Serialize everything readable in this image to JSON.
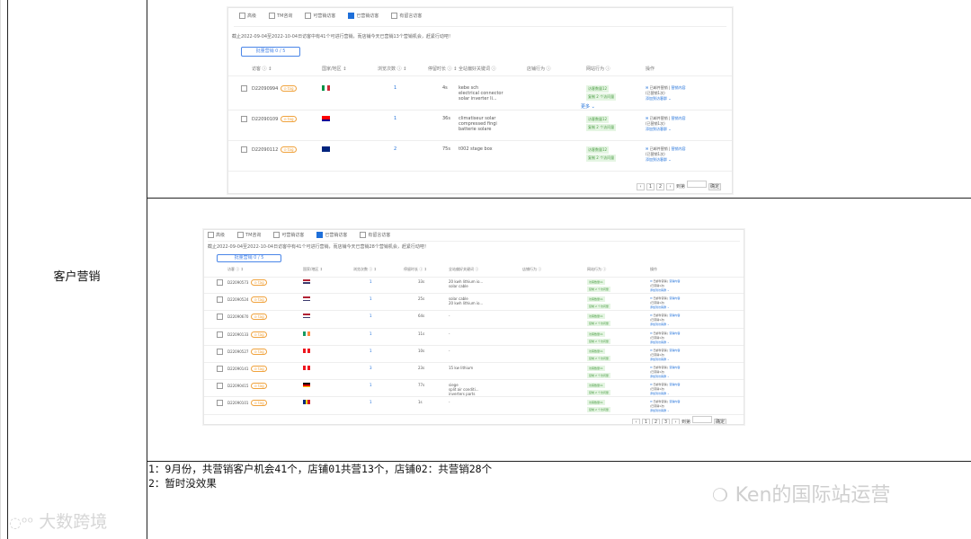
{
  "section_label": "客户营销",
  "notes": [
    "1：9月份，共营销客户机会41个，店铺01共营13个，店铺02：共营销28个",
    "2：暂时没效果"
  ],
  "watermark_left": "大数跨境",
  "watermark_right": "Ken的国际站运营",
  "shot1": {
    "filters": [
      "高级",
      "TM咨询",
      "可营销访客",
      "已营销访客",
      "有留言访客"
    ],
    "filters_checked": [
      false,
      false,
      false,
      true,
      false
    ],
    "notice": "截止2022-09-04至2022-10-04日访客中有41个可进行营销，而店铺今天已营销13个营销机会，赶紧行动吧！",
    "batch_button": "批量营销 0 / 5",
    "headers": [
      "访客 ⓘ ↕",
      "国家/地区 ↕",
      "浏览次数 ⓘ ↕",
      "停留时长 ⓘ ↕",
      "全站偏好关键词 ⓘ",
      "店铺行为 ⓘ",
      "网站行为 ⓘ",
      "操作"
    ],
    "rows": [
      {
        "id": "D22090994",
        "flag": "it",
        "visits": "1",
        "stay": "4s",
        "keywords": [
          "kebe sch",
          "electrical connector",
          "solar inverter li..."
        ],
        "more": "更多 ⌄"
      },
      {
        "id": "D22090109",
        "flag": "tw",
        "visits": "1",
        "stay": "36s",
        "keywords": [
          "climatiseur solar",
          "compressed fingi",
          "batterie solare"
        ],
        "more": ""
      },
      {
        "id": "D22090112",
        "flag": "au",
        "visits": "2",
        "stay": "75s",
        "keywords": [
          "t002 stage box"
        ],
        "more": ""
      }
    ],
    "green_labels": [
      "访客数量12",
      "复制 2 个访问量"
    ],
    "ops": [
      "已邮件营销",
      "营销内容",
      "(已营销1次)",
      "添加到访客群 ⌄"
    ],
    "pager": [
      "‹",
      "1",
      "2",
      "›",
      "到第",
      "确定"
    ]
  },
  "shot2": {
    "filters": [
      "高级",
      "TM咨询",
      "可营销访客",
      "已营销访客",
      "有留言访客"
    ],
    "filters_checked": [
      false,
      false,
      false,
      true,
      false
    ],
    "notice": "截止2022-09-04至2022-10-04日访客中有41个可进行营销，而店铺今天已营销28个营销机会，赶紧行动吧！",
    "batch_button": "批量营销 0 / 5",
    "headers": [
      "访客 ⓘ ↕",
      "国家/地区 ↕",
      "浏览次数 ⓘ ↕",
      "停留时长 ⓘ ↕",
      "全站偏好关键词 ⓘ",
      "店铺行为 ⓘ",
      "网站行为 ⓘ",
      "操作"
    ],
    "rows": [
      {
        "id": "D22090573",
        "flag": "us",
        "visits": "1",
        "stay": "33s",
        "keywords": [
          "20 kwh lithium io...",
          "solar cable"
        ]
      },
      {
        "id": "D22090524",
        "flag": "us",
        "visits": "1",
        "stay": "25s",
        "keywords": [
          "solar cable",
          "20 kwh lithium io..."
        ]
      },
      {
        "id": "D22090670",
        "flag": "us",
        "visits": "1",
        "stay": "64s",
        "keywords": [
          "-"
        ]
      },
      {
        "id": "D22090133",
        "flag": "ie",
        "visits": "1",
        "stay": "11s",
        "keywords": [
          "-"
        ]
      },
      {
        "id": "D22090527",
        "flag": "lb",
        "visits": "1",
        "stay": "10s",
        "keywords": [
          "-"
        ]
      },
      {
        "id": "D22090141",
        "flag": "lb",
        "visits": "3",
        "stay": "23s",
        "keywords": [
          "15 kw lithium"
        ]
      },
      {
        "id": "D22090415",
        "flag": "de",
        "visits": "1",
        "stay": "77s",
        "keywords": [
          "siege",
          "split air conditi...",
          "inverters parts"
        ]
      },
      {
        "id": "D22090101",
        "flag": "ro",
        "visits": "1",
        "stay": "1s",
        "keywords": [
          "-"
        ]
      }
    ],
    "green_labels": [
      "访客数量11",
      "复制 2 个访问量"
    ],
    "ops": [
      "已邮件营销",
      "营销内容",
      "(已营销1次)",
      "添加到访客群 ⌄"
    ],
    "pager": [
      "‹",
      "1",
      "2",
      "3",
      "›",
      "到第",
      "确定"
    ]
  }
}
